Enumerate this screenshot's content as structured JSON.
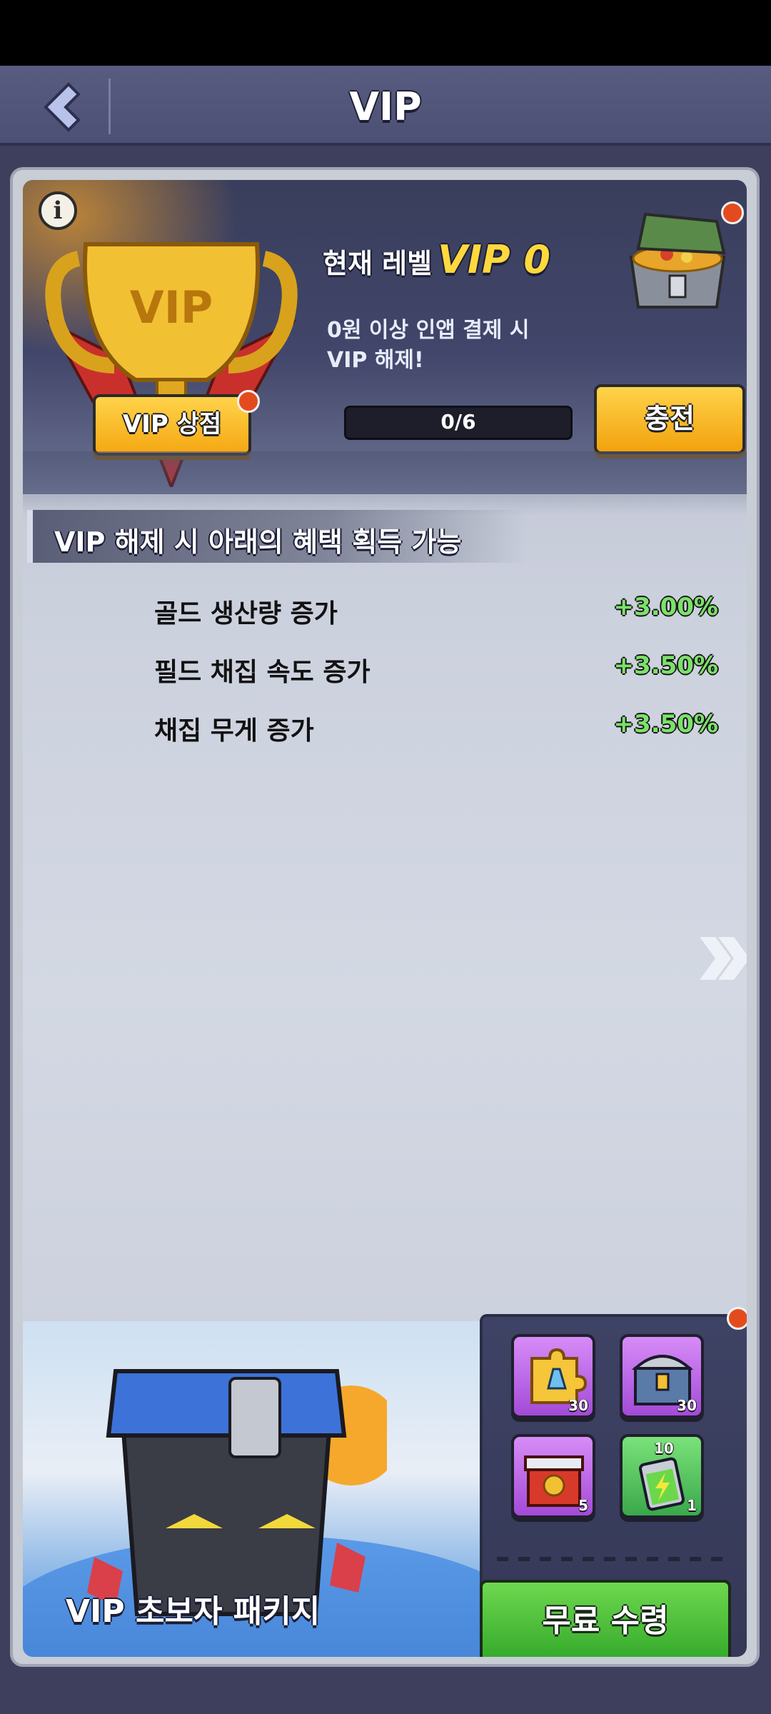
{
  "header": {
    "title": "VIP",
    "back_icon": "chevron-left-icon"
  },
  "vip": {
    "trophy_text": "VIP",
    "shop_label": "VIP 상점",
    "level_label": "현재 레벨",
    "level_value": "VIP 0",
    "unlock_desc_line1": "0원 이상 인앱 결제 시",
    "unlock_desc_line2": "VIP 해제!",
    "progress": "0/6",
    "progress_fraction": 0,
    "charge_label": "충전"
  },
  "benefits": {
    "header": "VIP 해제 시 아래의 혜택 획득 가능",
    "items": [
      {
        "name": "골드 생산량 증가",
        "value": "+3.00%"
      },
      {
        "name": "필드 채집 속도 증가",
        "value": "+3.50%"
      },
      {
        "name": "채집 무게 증가",
        "value": "+3.50%"
      }
    ]
  },
  "package": {
    "title": "VIP 초보자 패키지",
    "rewards": [
      {
        "icon": "research-puzzle-icon",
        "count": "30",
        "color": "purple"
      },
      {
        "icon": "treasure-chest-icon",
        "count": "30",
        "color": "purple"
      },
      {
        "icon": "red-gift-box-icon",
        "count": "5",
        "color": "purple"
      },
      {
        "icon": "energy-battery-icon",
        "count": "1",
        "badge": "10",
        "color": "green"
      }
    ],
    "claim_label": "무료 수령"
  },
  "colors": {
    "accent_gold": "#f5a814",
    "benefit_green": "#7be26a",
    "notification_red": "#e34b1e",
    "claim_green": "#34a82a"
  }
}
